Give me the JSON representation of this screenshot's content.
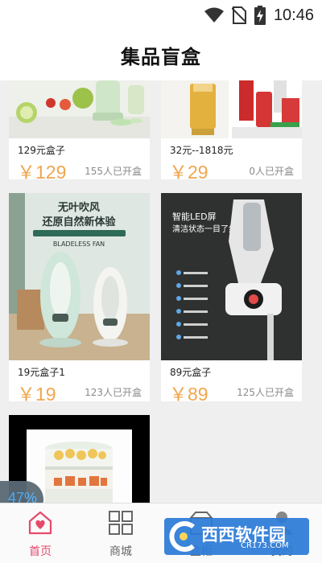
{
  "status_bar": {
    "time": "10:46"
  },
  "header": {
    "title": "集品盲盒"
  },
  "products": [
    {
      "name": "129元盒子",
      "price": "￥129",
      "opened": "155人已开盒"
    },
    {
      "name": "32元--1818元",
      "price": "￥29",
      "opened": "0人已开盒"
    },
    {
      "name": "19元盒子1",
      "price": "￥19",
      "opened": "123人已开盒"
    },
    {
      "name": "89元盒子",
      "price": "￥89",
      "opened": "125人已开盒"
    }
  ],
  "images": {
    "fan": {
      "title1": "无叶吹风",
      "title2": "还原自然新体验",
      "subtitle": "BLADELESS FAN"
    },
    "vacuum": {
      "title1": "智能LED屏",
      "title2": "清洁状态一目了然"
    }
  },
  "loading": {
    "progress": "47%"
  },
  "tabs": [
    {
      "label": "首页",
      "icon": "home-heart-icon",
      "active": true
    },
    {
      "label": "商城",
      "icon": "grid-icon",
      "active": false
    },
    {
      "label": "盒柜",
      "icon": "box-cabinet-icon",
      "active": false
    },
    {
      "label": "我的",
      "icon": "user-icon",
      "active": false
    }
  ],
  "watermark": {
    "text": "西西软件园",
    "url": "CR173.COM"
  },
  "colors": {
    "price": "#f0a64d",
    "tab_active": "#e64a6b",
    "background": "#efefef"
  }
}
